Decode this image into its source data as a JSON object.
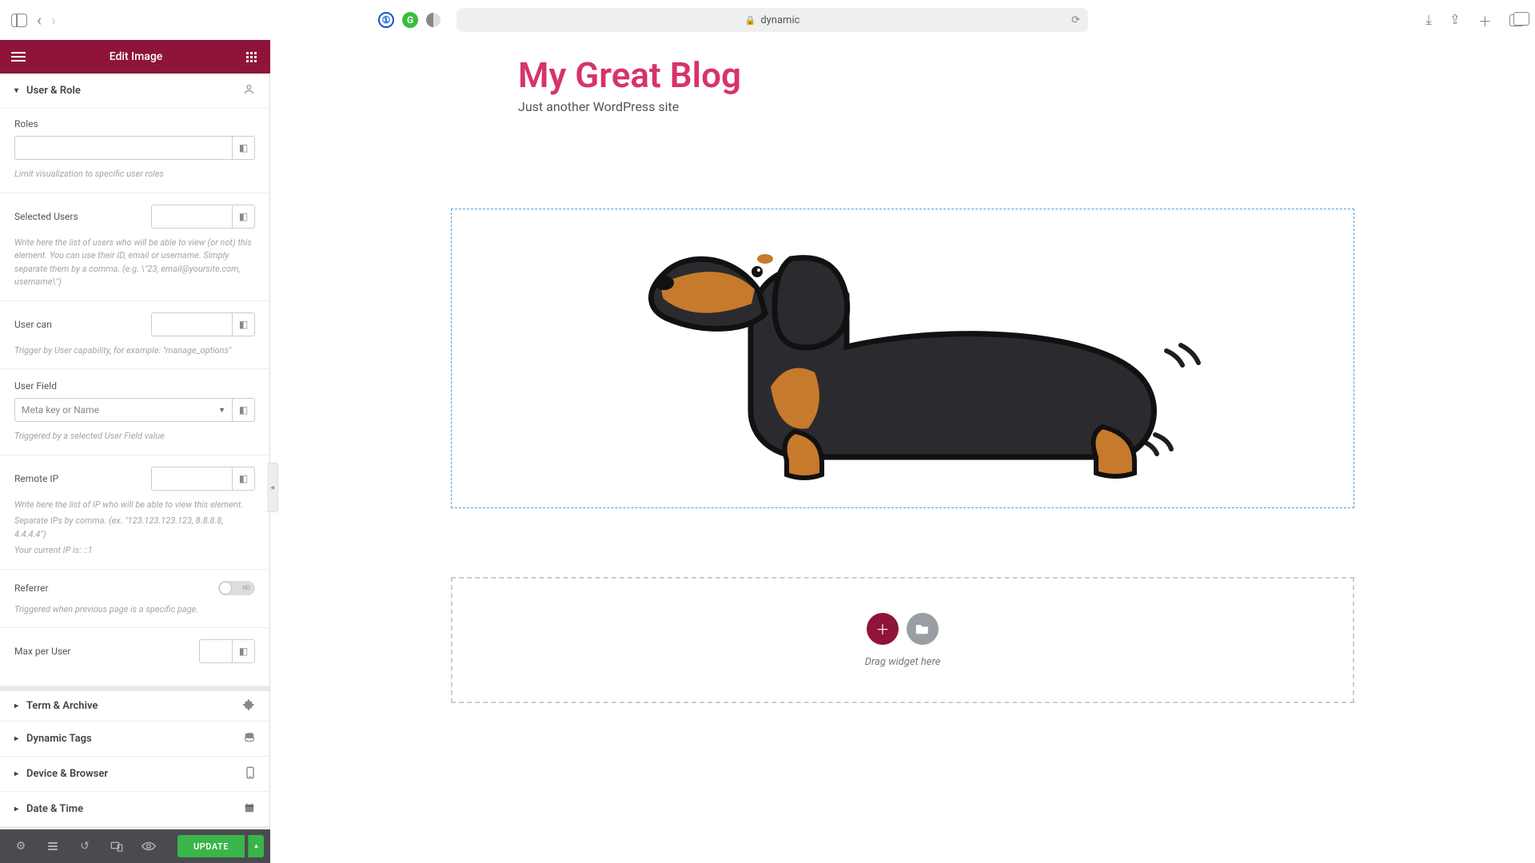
{
  "browser": {
    "url_display": "dynamic",
    "lock_label": "Secure"
  },
  "sidebar": {
    "header_title": "Edit Image",
    "sections": {
      "user_role": {
        "title": "User & Role",
        "roles_label": "Roles",
        "roles_hint": "Limit visualization to specific user roles",
        "selected_users_label": "Selected Users",
        "selected_users_hint": "Write here the list of users who will be able to view (or not) this element. You can use their ID, email or username. Simply separate them by a comma. (e.g. \\\"23, email@yoursite.com, username\\\")",
        "user_can_label": "User can",
        "user_can_hint": "Trigger by User capability, for example: \"manage_options\"",
        "user_field_label": "User Field",
        "user_field_placeholder": "Meta key or Name",
        "user_field_hint": "Triggered by a selected User Field value",
        "remote_ip_label": "Remote IP",
        "remote_ip_hint_1": "Write here the list of IP who will be able to view this element.",
        "remote_ip_hint_2": "Separate IPs by comma. (ex. \"123.123.123.123, 8.8.8.8, 4.4.4.4\")",
        "remote_ip_hint_3": "Your current IP is: ::1",
        "referrer_label": "Referrer",
        "referrer_toggle": "NO",
        "referrer_hint": "Triggered when previous page is a specific page.",
        "max_per_user_label": "Max per User"
      },
      "term_archive": "Term & Archive",
      "dynamic_tags": "Dynamic Tags",
      "device_browser": "Device & Browser",
      "date_time": "Date & Time"
    },
    "footer": {
      "update_label": "UPDATE"
    }
  },
  "canvas": {
    "blog_title": "My Great Blog",
    "blog_tagline": "Just another WordPress site",
    "drop_hint": "Drag widget here"
  }
}
